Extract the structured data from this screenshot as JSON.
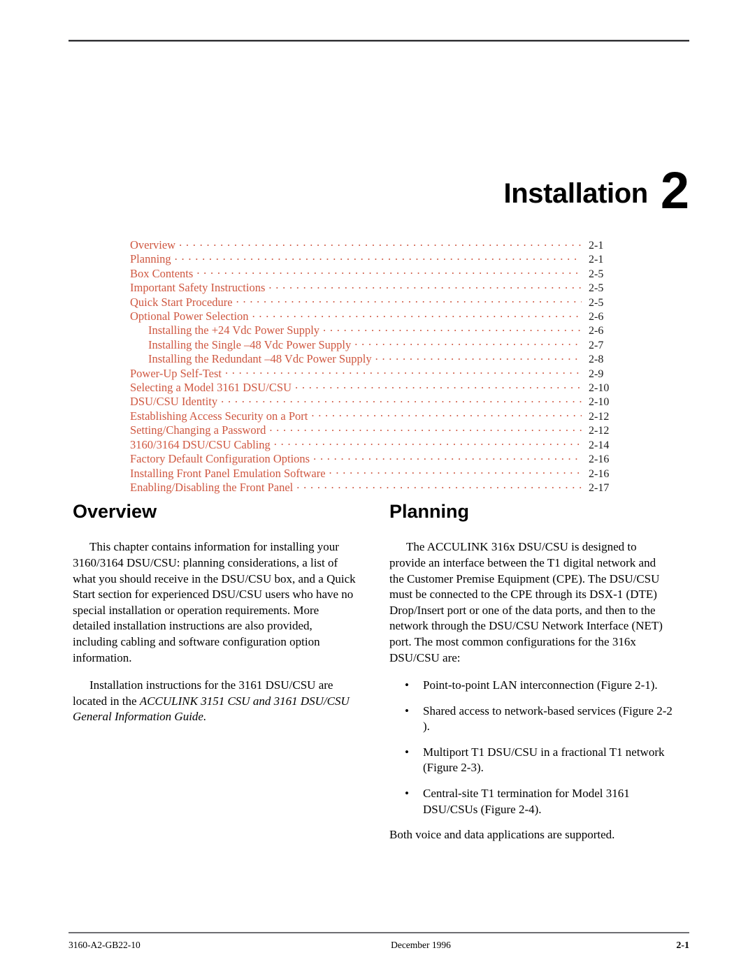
{
  "chapter": {
    "title": "Installation",
    "number": "2"
  },
  "toc": {
    "entries": [
      {
        "label": "Overview",
        "page": "2-1",
        "level": 1
      },
      {
        "label": "Planning",
        "page": "2-1",
        "level": 1
      },
      {
        "label": "Box Contents",
        "page": "2-5",
        "level": 1
      },
      {
        "label": "Important Safety Instructions",
        "page": "2-5",
        "level": 1
      },
      {
        "label": "Quick Start Procedure",
        "page": "2-5",
        "level": 1
      },
      {
        "label": "Optional Power Selection",
        "page": "2-6",
        "level": 1
      },
      {
        "label": "Installing the +24 Vdc Power Supply",
        "page": "2-6",
        "level": 2
      },
      {
        "label": "Installing the Single –48 Vdc Power Supply",
        "page": "2-7",
        "level": 2
      },
      {
        "label": "Installing the Redundant –48 Vdc Power Supply",
        "page": "2-8",
        "level": 2
      },
      {
        "label": "Power-Up Self-Test",
        "page": "2-9",
        "level": 1
      },
      {
        "label": "Selecting a Model 3161 DSU/CSU",
        "page": "2-10",
        "level": 1
      },
      {
        "label": "DSU/CSU Identity",
        "page": "2-10",
        "level": 1
      },
      {
        "label": "Establishing Access Security on a Port",
        "page": "2-12",
        "level": 1
      },
      {
        "label": "Setting/Changing a Password",
        "page": "2-12",
        "level": 1
      },
      {
        "label": "3160/3164 DSU/CSU Cabling",
        "page": "2-14",
        "level": 1
      },
      {
        "label": "Factory Default Configuration Options",
        "page": "2-16",
        "level": 1
      },
      {
        "label": "Installing Front Panel Emulation Software",
        "page": "2-16",
        "level": 1
      },
      {
        "label": "Enabling/Disabling the Front Panel",
        "page": "2-17",
        "level": 1
      }
    ]
  },
  "overview": {
    "heading": "Overview",
    "paragraph_1": "This chapter contains information for installing your 3160/3164 DSU/CSU: planning considerations, a list of what you should receive in the DSU/CSU box, and a Quick Start section for experienced DSU/CSU users who have no special installation or operation requirements. More detailed installation instructions are also provided, including cabling and software configuration option information.",
    "paragraph_2_lead": "Installation instructions for the 3161 DSU/CSU are located in the ",
    "paragraph_2_italic": "ACCULINK 3151 CSU and 3161 DSU/CSU General Information Guide.",
    "paragraph_2_tail": ""
  },
  "planning": {
    "heading": "Planning",
    "paragraph_1": "The ACCULINK 316x DSU/CSU is designed to provide an interface between the T1 digital network and the Customer Premise Equipment (CPE). The DSU/CSU must be connected to the CPE through its DSX-1 (DTE) Drop/Insert port or one of the data ports, and then to the network through the DSU/CSU Network Interface (NET) port. The most common configurations for the 316x DSU/CSU are:",
    "bullet_glyph": "•",
    "bullets": [
      "Point-to-point LAN interconnection (Figure 2-1).",
      "Shared access to network-based services (Figure 2-2 ).",
      "Multiport T1 DSU/CSU in a fractional T1 network (Figure 2-3).",
      "Central-site T1 termination for Model 3161 DSU/CSUs (Figure 2-4)."
    ],
    "closing_paragraph": "Both voice and data applications are supported."
  },
  "footer": {
    "doc_id": "3160-A2-GB22-10",
    "date": "December 1996",
    "page": "2-1"
  },
  "colors": {
    "toc_text": "#cf5740",
    "body_text": "#000000",
    "rule_dark": "#333336",
    "rule_footer": "#6e6e72"
  }
}
